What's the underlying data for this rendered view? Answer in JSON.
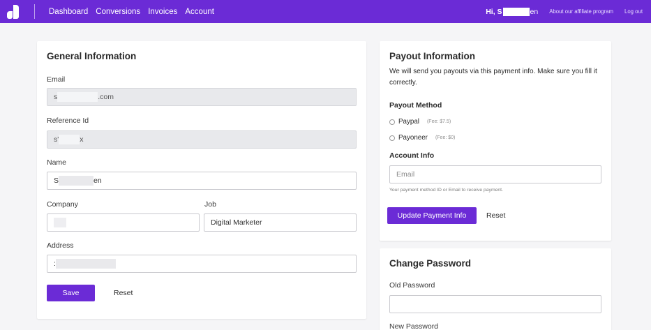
{
  "topbar": {
    "nav": [
      "Dashboard",
      "Conversions",
      "Invoices",
      "Account"
    ],
    "greeting_prefix": "Hi, S",
    "greeting_suffix": "en",
    "affiliate_link": "About our affiliate program",
    "logout": "Log out",
    "accent_color": "#6b2bd6"
  },
  "general": {
    "title": "General Information",
    "email_label": "Email",
    "email_value_prefix": "s",
    "email_value_suffix": ".com",
    "reference_label": "Reference Id",
    "reference_value_prefix": "s'",
    "reference_value_suffix": "x",
    "name_label": "Name",
    "name_value_prefix": "S",
    "name_value_suffix": "en",
    "company_label": "Company",
    "job_label": "Job",
    "job_value": "Digital Marketer",
    "address_label": "Address",
    "address_value_prefix": ":",
    "save_label": "Save",
    "reset_label": "Reset"
  },
  "payout": {
    "title": "Payout Information",
    "description": "We will send you payouts via this payment info. Make sure you fill it correctly.",
    "method_label": "Payout Method",
    "methods": [
      {
        "label": "Paypal",
        "fee": "(Fee: $7.5)"
      },
      {
        "label": "Payoneer",
        "fee": "(Fee: $0)"
      }
    ],
    "account_label": "Account Info",
    "account_placeholder": "Email",
    "account_help": "Your payment method ID or Email to receive payment.",
    "update_label": "Update Payment Info",
    "reset_label": "Reset"
  },
  "password": {
    "title": "Change Password",
    "old_label": "Old Password",
    "new_label": "New Password"
  }
}
